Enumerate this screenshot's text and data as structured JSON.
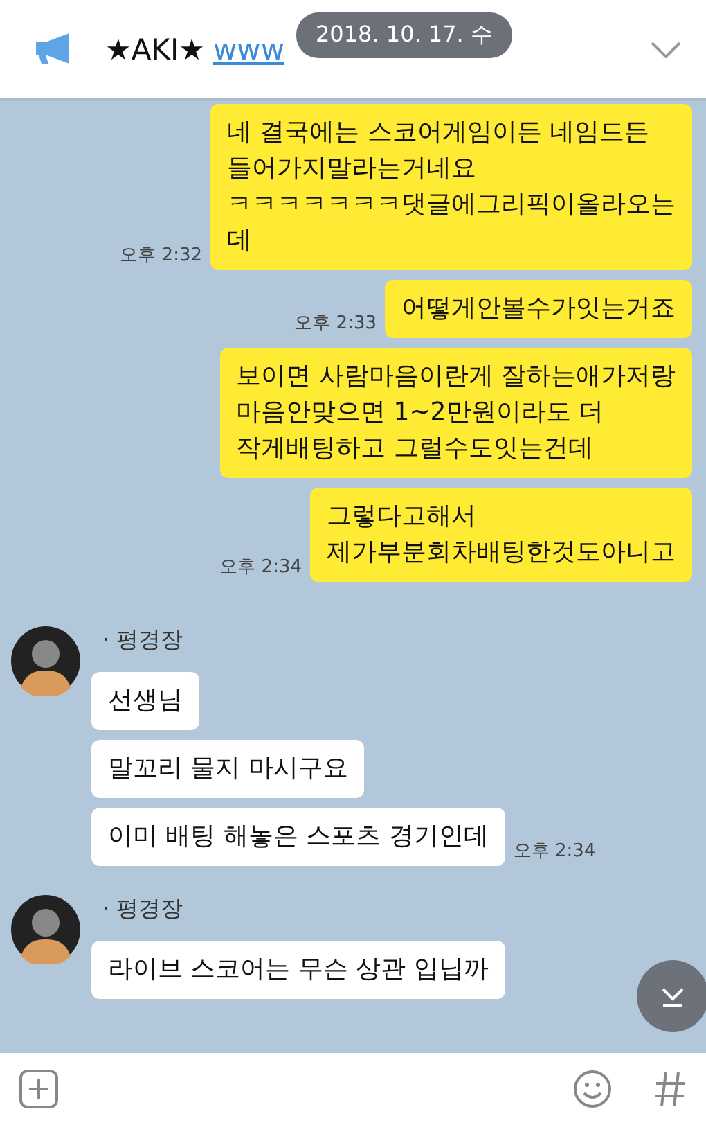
{
  "header": {
    "title": "★AKI★",
    "link": "www",
    "date_pill": "2018. 10. 17. 수"
  },
  "messages": [
    {
      "kind": "mine",
      "text": "네 결국에는 스코어게임이든 네임드든\n들어가지말라는거네요\nㅋㅋㅋㅋㅋㅋㅋ댓글에그리픽이올라오는\n데",
      "time": "오후 2:32"
    },
    {
      "kind": "mine",
      "text": "어떻게안볼수가잇는거죠",
      "time": "오후 2:33"
    },
    {
      "kind": "mine",
      "text": "보이면 사람마음이란게 잘하는애가저랑\n마음안맞으면 1~2만원이라도 더\n작게배팅하고 그럴수도잇는건데"
    },
    {
      "kind": "mine",
      "text": "그렇다고해서\n제가부분회차배팅한것도아니고",
      "time": "오후 2:34"
    },
    {
      "kind": "theirs",
      "sender": "· 평경장",
      "text": "선생님"
    },
    {
      "kind": "theirs",
      "text": "말꼬리 물지 마시구요"
    },
    {
      "kind": "theirs",
      "text": "이미 배팅 해놓은 스포츠 경기인데",
      "time": "오후 2:34"
    },
    {
      "kind": "theirs",
      "sender": "· 평경장",
      "text": "라이브 스코어는 무슨 상관 입닙까"
    }
  ]
}
